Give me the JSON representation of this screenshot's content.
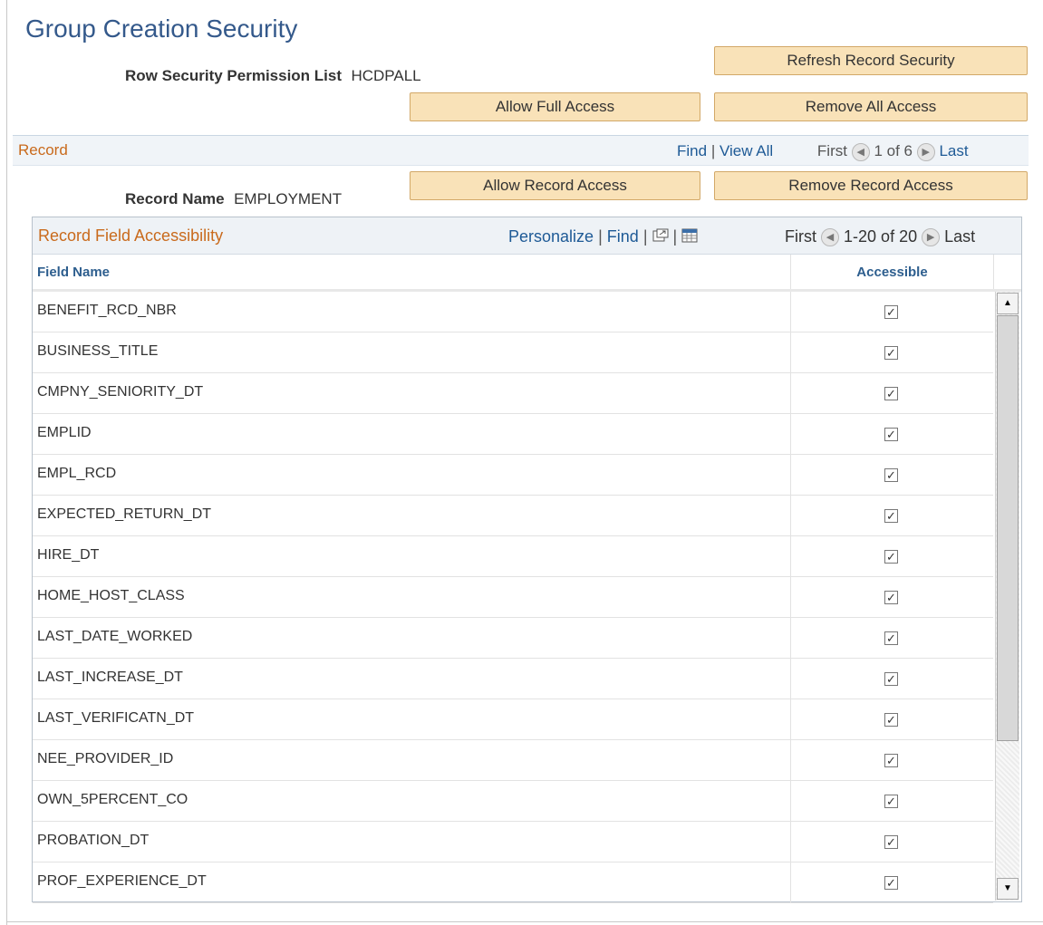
{
  "page": {
    "title": "Group Creation Security",
    "permission_label": "Row Security Permission List",
    "permission_value": "HCDPALL",
    "buttons": {
      "refresh": "Refresh Record Security",
      "allow_full": "Allow Full Access",
      "remove_all": "Remove All Access"
    }
  },
  "record": {
    "section_title": "Record",
    "find": "Find",
    "sep": "|",
    "view_all": "View All",
    "first": "First",
    "range": "1 of 6",
    "last": "Last",
    "name_label": "Record Name",
    "name_value": "EMPLOYMENT",
    "allow_btn": "Allow Record Access",
    "remove_btn": "Remove Record Access"
  },
  "grid": {
    "title": "Record Field Accessibility",
    "personalize": "Personalize",
    "find": "Find",
    "sep": "|",
    "first": "First",
    "range": "1-20 of 20",
    "last": "Last",
    "col_field": "Field Name",
    "col_accessible": "Accessible",
    "check_glyph": "✓",
    "rows": [
      {
        "name": "BENEFIT_RCD_NBR",
        "accessible": true
      },
      {
        "name": "BUSINESS_TITLE",
        "accessible": true
      },
      {
        "name": "CMPNY_SENIORITY_DT",
        "accessible": true
      },
      {
        "name": "EMPLID",
        "accessible": true
      },
      {
        "name": "EMPL_RCD",
        "accessible": true
      },
      {
        "name": "EXPECTED_RETURN_DT",
        "accessible": true
      },
      {
        "name": "HIRE_DT",
        "accessible": true
      },
      {
        "name": "HOME_HOST_CLASS",
        "accessible": true
      },
      {
        "name": "LAST_DATE_WORKED",
        "accessible": true
      },
      {
        "name": "LAST_INCREASE_DT",
        "accessible": true
      },
      {
        "name": "LAST_VERIFICATN_DT",
        "accessible": true
      },
      {
        "name": "NEE_PROVIDER_ID",
        "accessible": true
      },
      {
        "name": "OWN_5PERCENT_CO",
        "accessible": true
      },
      {
        "name": "PROBATION_DT",
        "accessible": true
      },
      {
        "name": "PROF_EXPERIENCE_DT",
        "accessible": true
      }
    ]
  },
  "icons": {
    "prev": "prev-arrow-icon",
    "next": "next-arrow-icon",
    "zoom": "zoom-grid-icon",
    "download": "download-grid-icon"
  }
}
